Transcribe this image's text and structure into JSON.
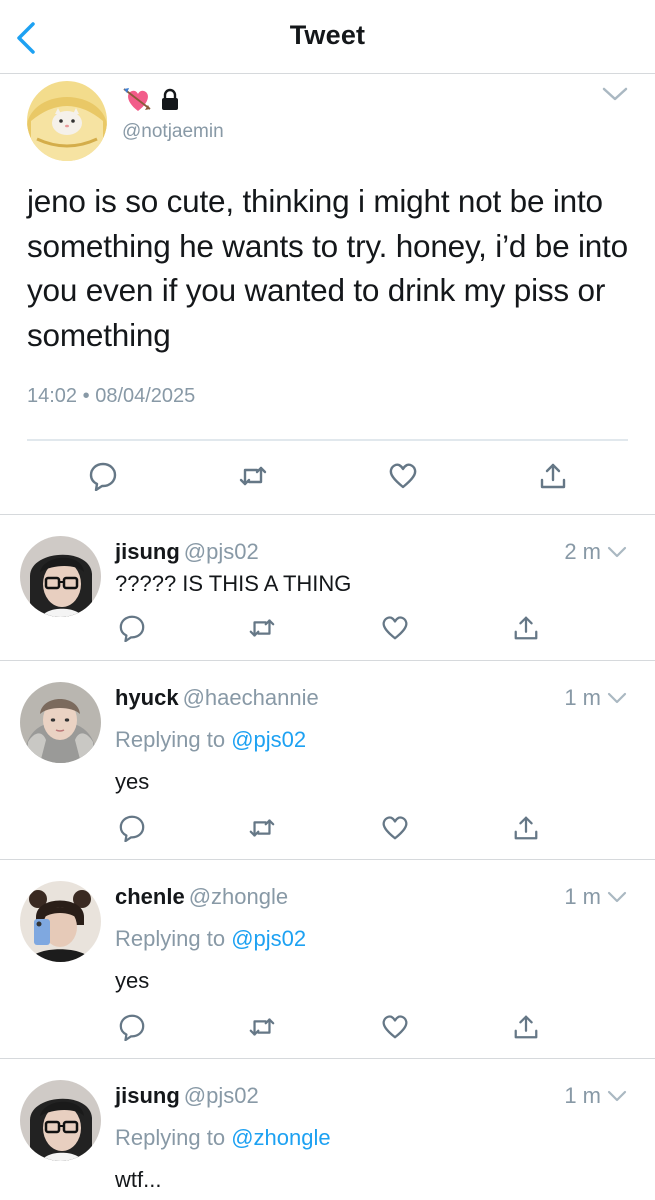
{
  "header": {
    "title": "Tweet",
    "back_icon": "chevron-left-icon"
  },
  "colors": {
    "accent": "#1da1f2",
    "text": "#14171a",
    "muted": "#8899a6",
    "divider": "#d6d9dc"
  },
  "main_tweet": {
    "badges": [
      "heart-with-arrow-emoji",
      "lock-icon"
    ],
    "handle": "@notjaemin",
    "text": "jeno is so cute, thinking i might not be into something he wants to try. honey, i’d be into you even if you wanted to drink my piss or something",
    "time": "14:02",
    "separator": "•",
    "date": "08/04/2025",
    "actions": [
      "reply-icon",
      "retweet-icon",
      "like-icon",
      "share-icon"
    ]
  },
  "replies": [
    {
      "name": "jisung",
      "handle": "@pjs02",
      "time": "2 m",
      "replying_label": "",
      "replying_to": "",
      "text": "????? IS THIS A THING"
    },
    {
      "name": "hyuck",
      "handle": "@haechannie",
      "time": "1 m",
      "replying_label": "Replying to",
      "replying_to": "@pjs02",
      "text": "yes"
    },
    {
      "name": "chenle",
      "handle": "@zhongle",
      "time": "1 m",
      "replying_label": "Replying to",
      "replying_to": "@pjs02",
      "text": "yes"
    },
    {
      "name": "jisung",
      "handle": "@pjs02",
      "time": "1 m",
      "replying_label": "Replying to",
      "replying_to": "@zhongle",
      "text": "wtf..."
    }
  ]
}
